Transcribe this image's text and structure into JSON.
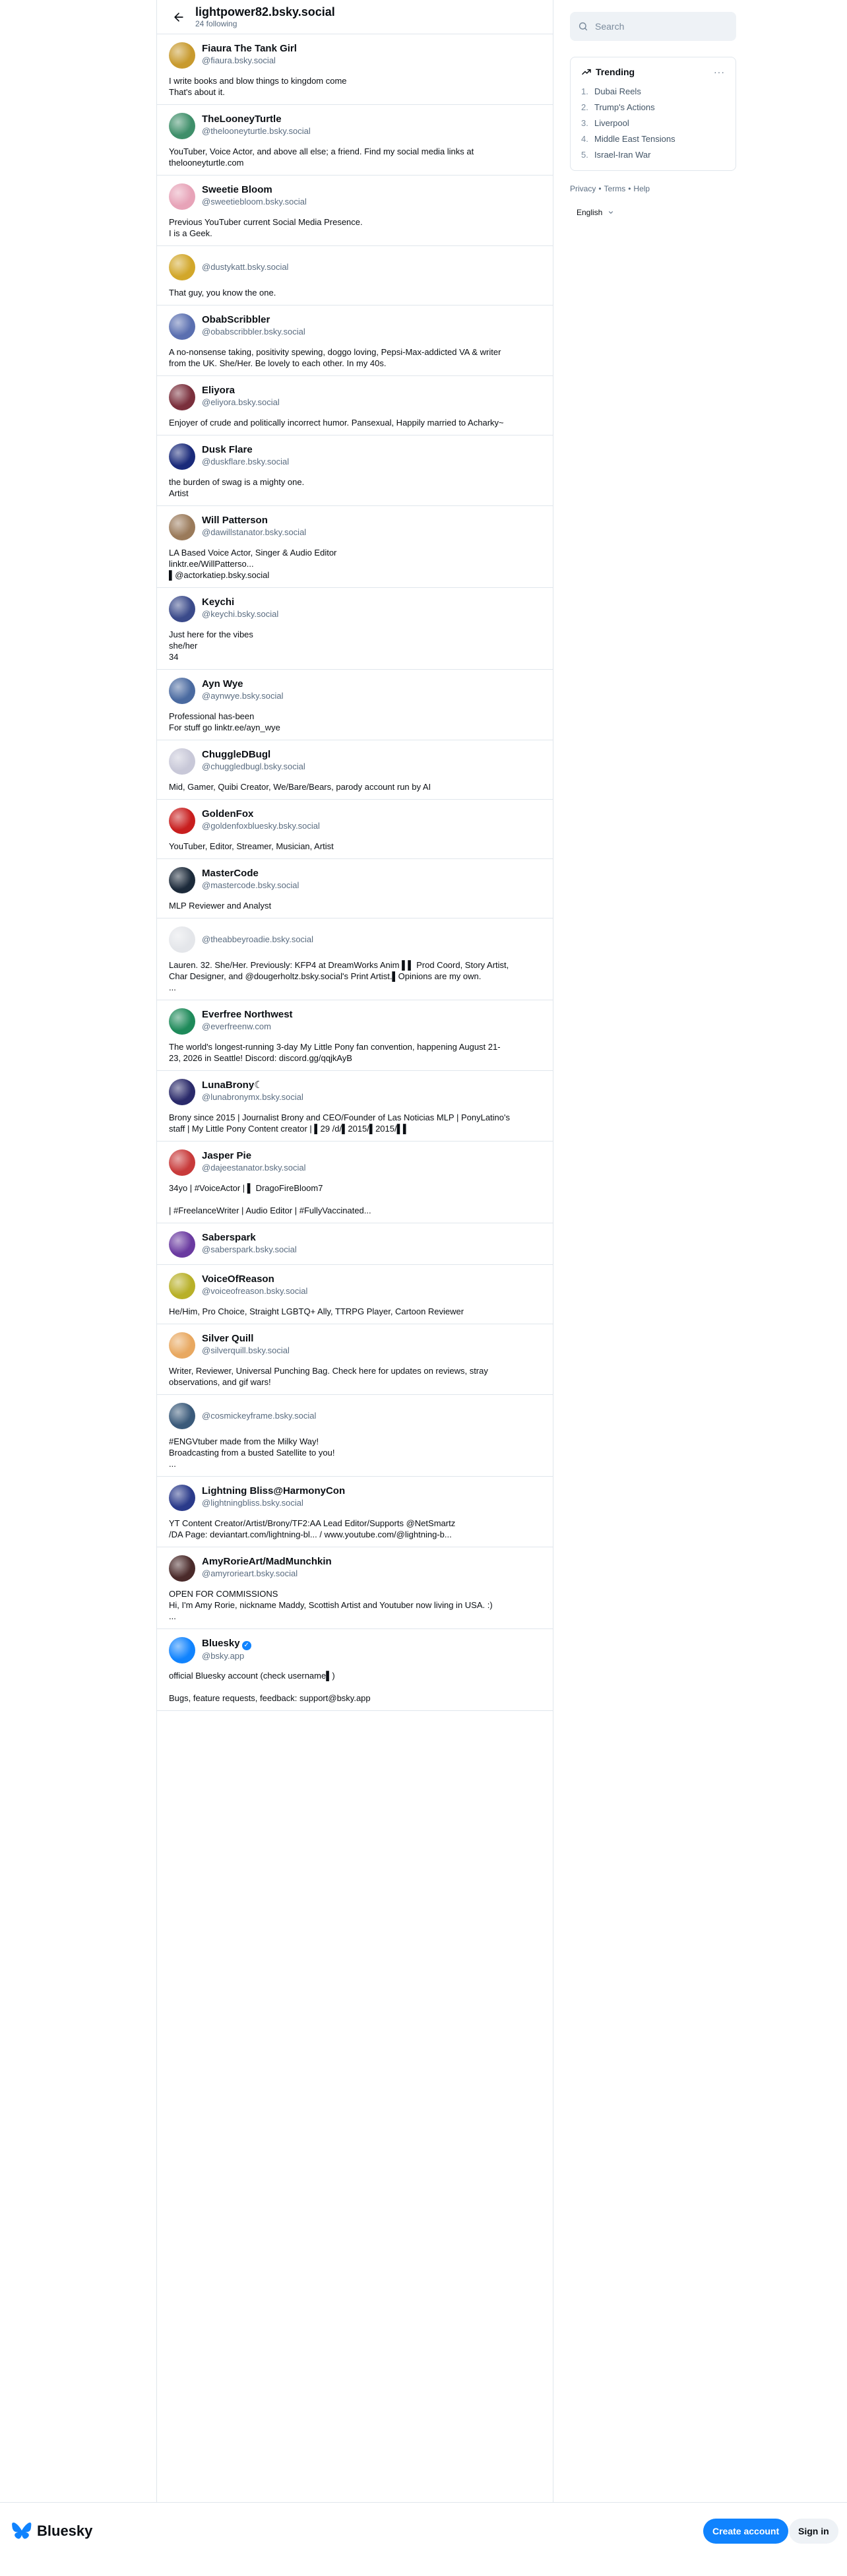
{
  "header": {
    "title": "lightpower82.bsky.social",
    "subtitle": "24 following"
  },
  "search": {
    "placeholder": "Search"
  },
  "trending": {
    "title": "Trending",
    "items": [
      {
        "num": "1.",
        "label": "Dubai Reels"
      },
      {
        "num": "2.",
        "label": "Trump's Actions"
      },
      {
        "num": "3.",
        "label": "Liverpool"
      },
      {
        "num": "4.",
        "label": "Middle East Tensions"
      },
      {
        "num": "5.",
        "label": "Israel-Iran War"
      }
    ]
  },
  "footer": {
    "privacy": "Privacy",
    "sep": "•",
    "terms": "Terms",
    "help": "Help"
  },
  "language": {
    "selected": "English"
  },
  "bottom": {
    "brand": "Bluesky",
    "create_account": "Create account",
    "sign_in": "Sign in"
  },
  "colors": {
    "accent": "#1083fe",
    "border": "#e0e6ec",
    "muted": "#5a6c80"
  },
  "follows": [
    {
      "name": "Fiaura The Tank Girl",
      "handle": "@fiaura.bsky.social",
      "bio": "I write books and blow things to kingdom come\nThat's about it.",
      "avatar": "#c89a2e"
    },
    {
      "name": "TheLooneyTurtle",
      "handle": "@thelooneyturtle.bsky.social",
      "bio": "YouTuber, Voice Actor, and above all else; a friend. Find my social media links at\nthelooneyturtle.com",
      "avatar": "#3f8f6a"
    },
    {
      "name": "Sweetie Bloom",
      "handle": "@sweetiebloom.bsky.social",
      "bio": "Previous YouTuber current Social Media Presence.\nI is a Geek.",
      "avatar": "#e7a3b8"
    },
    {
      "name": "",
      "handle": "@dustykatt.bsky.social",
      "bio": "That guy, you know the one.",
      "avatar": "#d2a72a"
    },
    {
      "name": "ObabScribbler",
      "handle": "@obabscribbler.bsky.social",
      "bio": "A no-nonsense taking, positivity spewing, doggo loving, Pepsi-Max-addicted VA & writer\nfrom the UK. She/Her. Be lovely to each other. In my 40s.",
      "avatar": "#5a6fb0"
    },
    {
      "name": "Eliyora",
      "handle": "@eliyora.bsky.social",
      "bio": "Enjoyer of crude and politically incorrect humor. Pansexual, Happily married to Acharky~",
      "avatar": "#7a2f3c"
    },
    {
      "name": "Dusk Flare",
      "handle": "@duskflare.bsky.social",
      "bio": "the burden of swag is a mighty one.\nArtist",
      "avatar": "#1a2a7a"
    },
    {
      "name": "Will Patterson",
      "handle": "@dawillstanator.bsky.social",
      "bio": "LA Based Voice Actor, Singer & Audio Editor\nlinktr.ee/WillPatterso...\n▌@actorkatiep.bsky.social",
      "avatar": "#9a7a5a"
    },
    {
      "name": "Keychi",
      "handle": "@keychi.bsky.social",
      "bio": "Just here for the vibes\nshe/her\n34",
      "avatar": "#3a4a8a"
    },
    {
      "name": "Ayn Wye",
      "handle": "@aynwye.bsky.social",
      "bio": "Professional has-been\nFor stuff go linktr.ee/ayn_wye",
      "avatar": "#4a6aa0"
    },
    {
      "name": "ChuggleDBugl",
      "handle": "@chuggledbugl.bsky.social",
      "bio": "Mid, Gamer, Quibi Creator, We/Bare/Bears, parody account run by AI",
      "avatar": "#c8c8d8"
    },
    {
      "name": "GoldenFox",
      "handle": "@goldenfoxbluesky.bsky.social",
      "bio": "YouTuber, Editor, Streamer, Musician, Artist",
      "avatar": "#c81e1e"
    },
    {
      "name": "MasterCode",
      "handle": "@mastercode.bsky.social",
      "bio": "MLP Reviewer and Analyst",
      "avatar": "#1c2a3a"
    },
    {
      "name": "",
      "handle": "@theabbeyroadie.bsky.social",
      "bio": "Lauren. 32. She/Her. Previously: KFP4 at DreamWorks Anim ▌▌ Prod Coord, Story Artist,\nChar Designer, and @dougerholtz.bsky.social's Print Artist.▌Opinions are my own.\n...",
      "avatar": "#e4e6ea"
    },
    {
      "name": "Everfree Northwest",
      "handle": "@everfreenw.com",
      "bio": "The world's longest-running 3-day My Little Pony fan convention, happening August 21-\n23, 2026 in Seattle! Discord: discord.gg/qqjkAyB",
      "avatar": "#1e8a5a"
    },
    {
      "name": "LunaBrony☾",
      "handle": "@lunabronymx.bsky.social",
      "bio": "Brony since 2015 | Journalist Brony and CEO/Founder of Las Noticias MLP | PonyLatino's\nstaff | My Little Pony Content creator | ▌29 /d/▌2015/▌2015/▌▌",
      "avatar": "#2a2a6a"
    },
    {
      "name": "Jasper Pie",
      "handle": "@dajeestanator.bsky.social",
      "bio": "34yo | #VoiceActor | ▌ DragoFireBloom7\n\n| #FreelanceWriter | Audio Editor | #FullyVaccinated...",
      "avatar": "#c83a3a"
    },
    {
      "name": "Saberspark",
      "handle": "@saberspark.bsky.social",
      "bio": "",
      "avatar": "#6a3aa0"
    },
    {
      "name": "VoiceOfReason",
      "handle": "@voiceofreason.bsky.social",
      "bio": "He/Him, Pro Choice, Straight LGBTQ+ Ally, TTRPG Player, Cartoon Reviewer",
      "avatar": "#b8b028"
    },
    {
      "name": "Silver Quill",
      "handle": "@silverquill.bsky.social",
      "bio": "Writer, Reviewer, Universal Punching Bag. Check here for updates on reviews, stray\nobservations, and gif wars!",
      "avatar": "#e8a860"
    },
    {
      "name": "",
      "handle": "@cosmickeyframe.bsky.social",
      "bio": "#ENGVtuber made from the Milky Way!\nBroadcasting from a busted Satellite to you!\n...",
      "avatar": "#3a5a7a"
    },
    {
      "name": "Lightning Bliss@HarmonyCon",
      "handle": "@lightningbliss.bsky.social",
      "bio": "YT Content Creator/Artist/Brony/TF2:AA Lead Editor/Supports @NetSmartz\n/DA Page: deviantart.com/lightning-bl... / www.youtube.com/@lightning-b...",
      "avatar": "#2a3a8a"
    },
    {
      "name": "AmyRorieArt/MadMunchkin",
      "handle": "@amyrorieart.bsky.social",
      "bio": "OPEN FOR COMMISSIONS\nHi, I'm Amy Rorie, nickname Maddy, Scottish Artist and Youtuber now living in USA. :)\n...",
      "avatar": "#4a2a2a"
    },
    {
      "name": "Bluesky",
      "handle": "@bsky.app",
      "bio": "official Bluesky account (check username▌)\n\nBugs, feature requests, feedback: support@bsky.app",
      "avatar": "#1083fe",
      "verified": true
    }
  ]
}
